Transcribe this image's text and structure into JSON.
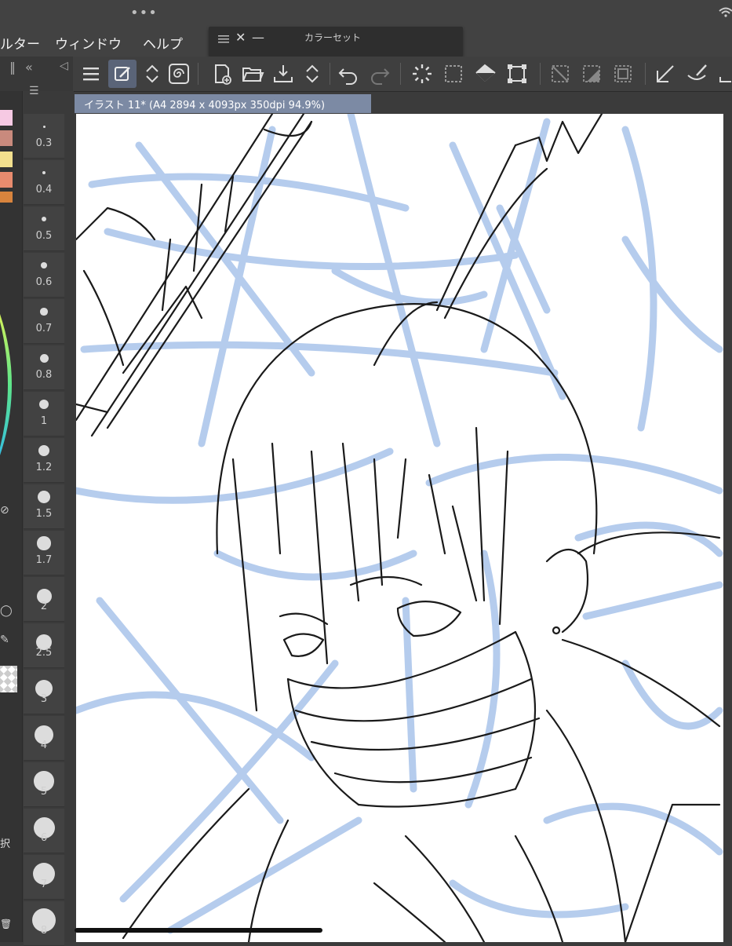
{
  "menubar": {
    "items": [
      "ルター",
      "ウィンドウ",
      "ヘルプ"
    ]
  },
  "color_set_palette": {
    "title": "カラーセット"
  },
  "canvas": {
    "tab_title": "イラスト 11* (A4 2894 x 4093px 350dpi 94.9%)"
  },
  "brush_size_palette": {
    "sizes": [
      "0.3",
      "0.4",
      "0.5",
      "0.6",
      "0.7",
      "0.8",
      "1",
      "1.2",
      "1.5",
      "1.7",
      "2",
      "2.5",
      "3",
      "4",
      "5",
      "6",
      "7",
      "8"
    ]
  },
  "left_panel": {
    "select_label": "択",
    "trash_label": "🗑"
  },
  "colors": {
    "accent_selected": "#5a6478",
    "canvas_tab": "#7c8aa4",
    "sketch_blue": "#a9c4ea",
    "line_black": "#1a1a1a"
  },
  "swatches": [
    "#f6c9e3",
    "#c98a7d",
    "#f3e08e",
    "#e88b6e",
    "#d8843d"
  ],
  "icons": [
    "multitask-dots-icon",
    "wifi-icon",
    "menu-icon",
    "edit-mode-icon",
    "up-down-arrows-icon",
    "spiral-icon",
    "new-canvas-icon",
    "open-folder-icon",
    "save-icon",
    "undo-icon",
    "redo-icon",
    "loading-icon",
    "select-all-icon",
    "fill-icon",
    "transform-icon",
    "deselect-icon",
    "invert-selection-icon",
    "border-icon",
    "ruler-icon",
    "brush-icon"
  ]
}
